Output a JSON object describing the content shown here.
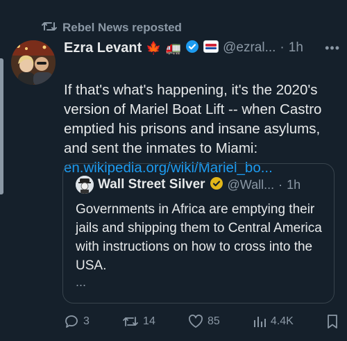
{
  "repost": {
    "label": "Rebel News reposted"
  },
  "tweet": {
    "display_name": "Ezra Levant",
    "emojis": [
      "🍁",
      "🚛"
    ],
    "handle": "@ezral...",
    "time_separator": "·",
    "time": "1h",
    "text": "If that's what's happening, it's the 2020's version of Mariel Boat Lift -- when Castro emptied his prisons and insane asylums, and sent the inmates to Miami:",
    "link": "en.wikipedia.org/wiki/Mariel_bo..."
  },
  "quote": {
    "display_name": "Wall Street Silver",
    "handle": "@Wall...",
    "time_separator": "·",
    "time": "1h",
    "text": "Governments in Africa are emptying their jails and shipping them to Central America with instructions on how to cross into the USA.",
    "ellipsis": "..."
  },
  "actions": {
    "replies": "3",
    "reposts": "14",
    "likes": "85",
    "views": "4.4K"
  },
  "colors": {
    "background": "#15202b",
    "text": "#e7e9ea",
    "secondary": "#8b98a5",
    "link": "#1d9bf0",
    "verified": "#1d9bf0",
    "gold_verified": "#e2b719",
    "border": "#38444d"
  }
}
